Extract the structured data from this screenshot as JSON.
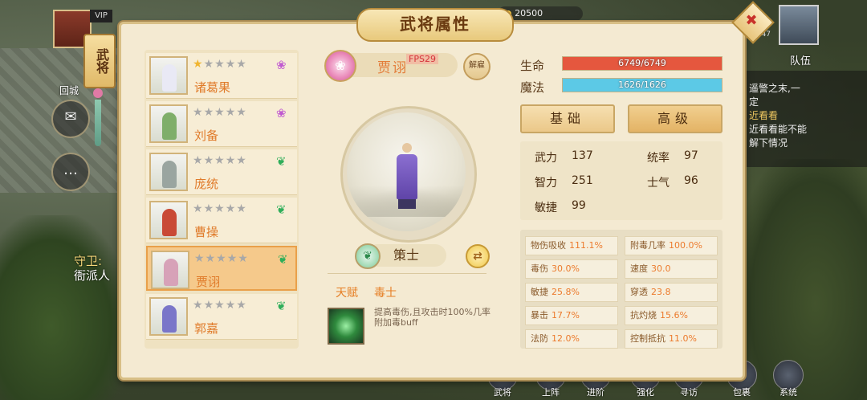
{
  "scene": {
    "city_label": "回城",
    "guard_title": "守卫:",
    "guard_text": "衙派人",
    "vip": "VIP",
    "gold": "20500",
    "level": "Lv.47",
    "team_label": "队伍",
    "chat": {
      "line1": "遥警之末,一",
      "line2": "定",
      "highlight": "近看看",
      "line3": "近看看能不能",
      "line4": "解下情况"
    },
    "bottom_menu": [
      "武将",
      "上阵",
      "进阶",
      "强化",
      "寻访",
      "包裹",
      "系统"
    ]
  },
  "panel": {
    "title": "武将属性",
    "side_tab": "武将",
    "close_glyph": "✖"
  },
  "heroes": [
    {
      "name": "诸葛果",
      "stars_gold": 1,
      "stars_total": 5,
      "element": "lotus",
      "element_glyph": "❀",
      "element_color": "#c05ad0",
      "selected": false,
      "fig_color": "#e9e9f5"
    },
    {
      "name": "刘备",
      "stars_gold": 0,
      "stars_total": 5,
      "element": "lotus",
      "element_glyph": "❀",
      "element_color": "#c05ad0",
      "selected": false,
      "fig_color": "#7fae6a"
    },
    {
      "name": "庞统",
      "stars_gold": 0,
      "stars_total": 5,
      "element": "leaf",
      "element_glyph": "❦",
      "element_color": "#2fae5a",
      "selected": false,
      "fig_color": "#9aa5a0"
    },
    {
      "name": "曹操",
      "stars_gold": 0,
      "stars_total": 5,
      "element": "leaf",
      "element_glyph": "❦",
      "element_color": "#2fae5a",
      "selected": false,
      "fig_color": "#c94a36"
    },
    {
      "name": "贾诩",
      "stars_gold": 0,
      "stars_total": 5,
      "element": "leaf",
      "element_glyph": "❦",
      "element_color": "#2fae5a",
      "selected": true,
      "fig_color": "#d7a2b8"
    },
    {
      "name": "郭嘉",
      "stars_gold": 0,
      "stars_total": 5,
      "element": "leaf",
      "element_glyph": "❦",
      "element_color": "#2fae5a",
      "selected": false,
      "fig_color": "#7a76c9"
    }
  ],
  "detail": {
    "hero_name": "贾诩",
    "fps": "FPS29",
    "dismiss": "解雇",
    "class_name": "策士",
    "class_glyph": "❦",
    "swap_glyph": "⇄",
    "talent_label": "天赋",
    "talent_name": "毒士",
    "talent_desc": "提高毒伤,且攻击时100%几率附加毒buff"
  },
  "stats": {
    "hp_label": "生命",
    "hp_text": "6749/6749",
    "hp_fraction": 1.0,
    "hp_color": "#e5573e",
    "mp_label": "魔法",
    "mp_text": "1626/1626",
    "mp_fraction": 1.0,
    "mp_color": "#5cc9e6",
    "tab_basic": "基础",
    "tab_advanced": "高级",
    "basic": [
      {
        "k": "武力",
        "v": "137"
      },
      {
        "k": "统率",
        "v": "97"
      },
      {
        "k": "智力",
        "v": "251"
      },
      {
        "k": "士气",
        "v": "96"
      },
      {
        "k": "敏捷",
        "v": "99"
      }
    ],
    "advanced": [
      {
        "k": "物伤吸收",
        "v": "111.1%"
      },
      {
        "k": "附毒几率",
        "v": "100.0%"
      },
      {
        "k": "毒伤",
        "v": "30.0%"
      },
      {
        "k": "速度",
        "v": "30.0"
      },
      {
        "k": "敏捷",
        "v": "25.8%"
      },
      {
        "k": "穿透",
        "v": "23.8"
      },
      {
        "k": "暴击",
        "v": "17.7%"
      },
      {
        "k": "抗灼烧",
        "v": "15.6%"
      },
      {
        "k": "法防",
        "v": "12.0%"
      },
      {
        "k": "控制抵抗",
        "v": "11.0%"
      }
    ]
  }
}
